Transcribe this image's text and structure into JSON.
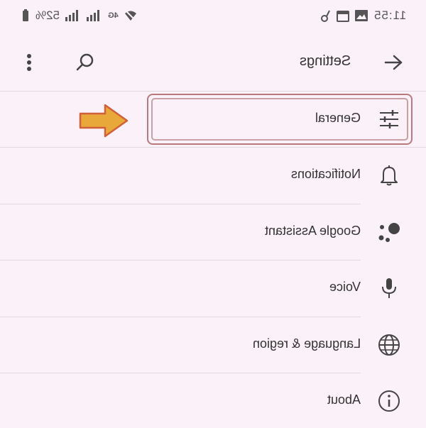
{
  "status_bar": {
    "time": "11:55",
    "battery": "52%",
    "network": "4G"
  },
  "app_bar": {
    "title": "Settings",
    "back_icon": "arrow-back-icon",
    "search_icon": "search-icon",
    "more_icon": "more-vert-icon"
  },
  "settings": {
    "items": [
      {
        "label": "General",
        "icon": "tune-icon"
      },
      {
        "label": "Notifications",
        "icon": "bell-icon"
      },
      {
        "label": "Google Assistant",
        "icon": "assistant-icon"
      },
      {
        "label": "Voice",
        "icon": "mic-icon"
      },
      {
        "label": "Language & region",
        "icon": "globe-icon"
      },
      {
        "label": "About",
        "icon": "info-icon"
      }
    ]
  },
  "colors": {
    "background": "#fbf1f8",
    "highlight": "#b97a7e",
    "arrow": "#e8a83a",
    "arrow_border": "#d0603a"
  }
}
